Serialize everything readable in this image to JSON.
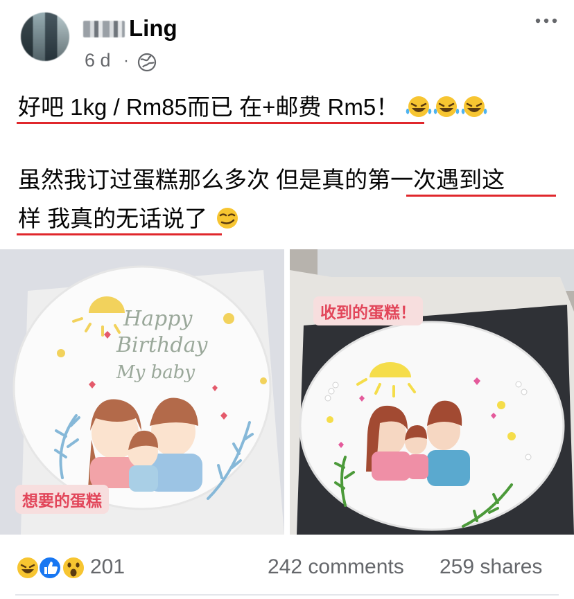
{
  "post": {
    "author": "Ling",
    "timestamp": "6 d",
    "separator": "·",
    "privacy_icon": "globe-icon",
    "menu_icon": "more-horizontal-icon",
    "text_line1": "好吧 1kg / Rm85而已 在+邮费 Rm5！",
    "text_line2": "虽然我订过蛋糕那么多次 但是真的第一次遇到这",
    "text_line3": "样 我真的无话说了",
    "emojis_line1": [
      "laughing-crying-emoji",
      "laughing-crying-emoji",
      "laughing-crying-emoji"
    ],
    "emoji_line3": "smirking-face-emoji",
    "highlight_color": "#e0272c"
  },
  "photos": {
    "left_tag": "想要的蛋糕",
    "right_tag": "收到的蛋糕！",
    "left_cake_text": [
      "Happy",
      "Birthday",
      "My baby"
    ]
  },
  "engagement": {
    "reaction_icons": [
      "haha-icon",
      "like-icon",
      "wow-icon"
    ],
    "reaction_count": "201",
    "comments": "242 comments",
    "shares": "259 shares"
  }
}
